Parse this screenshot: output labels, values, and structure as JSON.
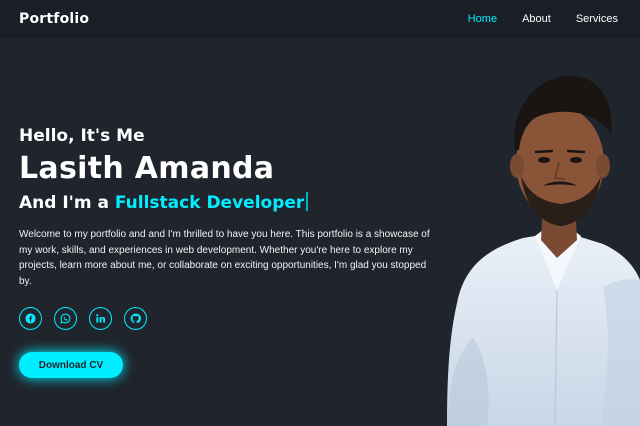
{
  "header": {
    "logo": "Portfolio",
    "nav": [
      {
        "label": "Home",
        "active": true
      },
      {
        "label": "About",
        "active": false
      },
      {
        "label": "Services",
        "active": false
      }
    ]
  },
  "hero": {
    "greeting": "Hello, It's Me",
    "name": "Lasith Amanda",
    "role_prefix": "And I'm a ",
    "role_highlight": "Fullstack Developer",
    "intro": "Welcome to my portfolio and and I'm thrilled to have you here. This portfolio is a showcase of my work, skills, and experiences in web development. Whether you're here to explore my projects, learn more about me, or collaborate on exciting opportunities, I'm glad you stopped by.",
    "social_icons": [
      "facebook-icon",
      "whatsapp-icon",
      "linkedin-icon",
      "github-icon"
    ],
    "cta_label": "Download CV"
  },
  "colors": {
    "background": "#1f242d",
    "accent": "#00eeff",
    "text": "#ffffff"
  }
}
